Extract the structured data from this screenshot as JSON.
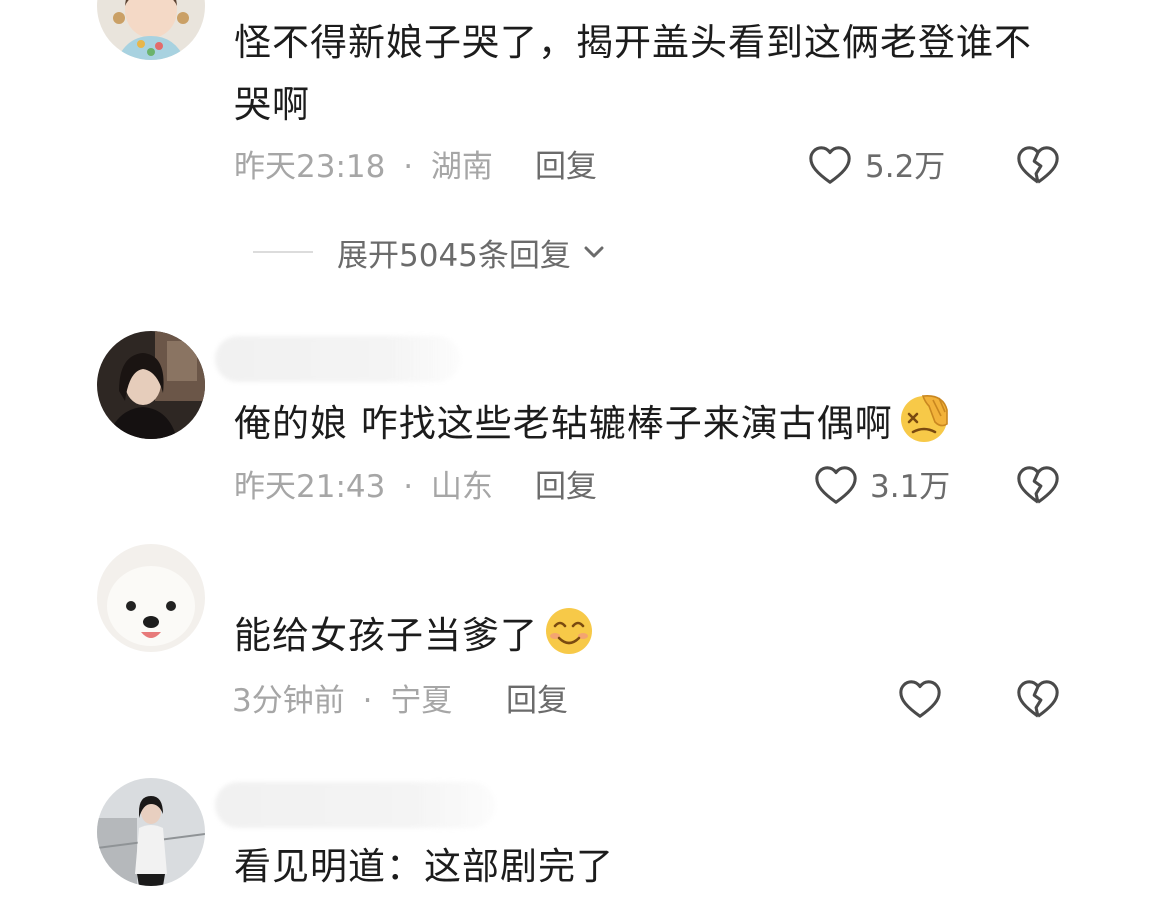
{
  "comments": [
    {
      "text_line1": "怪不得新娘子哭了，揭开盖头看到这俩老登谁不",
      "text_line2": "哭啊",
      "time": "昨天23:18",
      "separator": "·",
      "location": "湖南",
      "reply_label": "回复",
      "like_count": "5.2万"
    },
    {
      "text": "俺的娘 咋找这些老轱辘棒子来演古偶啊",
      "time": "昨天21:43",
      "separator": "·",
      "location": "山东",
      "reply_label": "回复",
      "like_count": "3.1万",
      "emoji": "facepalm-emoji"
    },
    {
      "text": "能给女孩子当爹了",
      "time": "3分钟前",
      "separator": "·",
      "location": "宁夏",
      "reply_label": "回复",
      "emoji": "smile-emoji"
    },
    {
      "text": "看见明道：这部剧完了"
    }
  ],
  "expand_replies": {
    "label": "展开5045条回复"
  },
  "icons": {
    "like": "heart-outline-icon",
    "dislike": "broken-heart-icon",
    "expand": "chevron-down-icon"
  },
  "colors": {
    "text": "#1c1c1c",
    "meta": "#a6a6a6",
    "action": "#6b6b6b",
    "icon": "#4a4a4a"
  }
}
